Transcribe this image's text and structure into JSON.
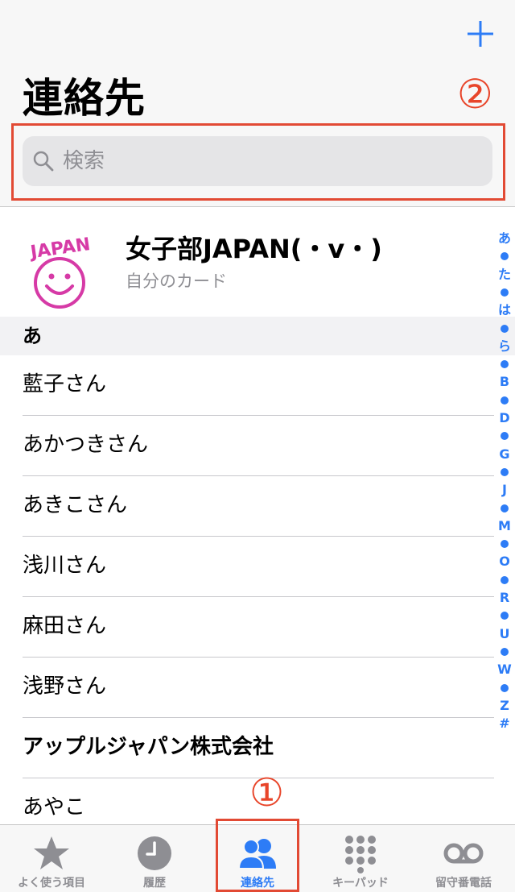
{
  "header": {
    "title": "連絡先",
    "add_icon": "plus-icon",
    "search_placeholder": "検索"
  },
  "annotations": {
    "search_marker": "②",
    "tab_marker": "①",
    "color": "#e24a34"
  },
  "my_card": {
    "name": "女子部JAPAN(・v・)",
    "subtitle": "自分のカード",
    "avatar_text": "JAPAN"
  },
  "sections": [
    {
      "header": "あ"
    }
  ],
  "contacts": [
    {
      "name": "藍子さん"
    },
    {
      "name": "あかつきさん"
    },
    {
      "name": "あきこさん"
    },
    {
      "name": "浅川さん"
    },
    {
      "name": "麻田さん"
    },
    {
      "name": "浅野さん"
    },
    {
      "name": "アップルジャパン株式会社"
    },
    {
      "name": "あやこ"
    }
  ],
  "index": [
    "あ",
    "•",
    "た",
    "•",
    "は",
    "•",
    "ら",
    "•",
    "B",
    "•",
    "D",
    "•",
    "G",
    "•",
    "J",
    "•",
    "M",
    "•",
    "O",
    "•",
    "R",
    "•",
    "U",
    "•",
    "W",
    "•",
    "Z",
    "#"
  ],
  "tabs": [
    {
      "label": "よく使う項目",
      "icon": "star-icon",
      "active": false
    },
    {
      "label": "履歴",
      "icon": "clock-icon",
      "active": false
    },
    {
      "label": "連絡先",
      "icon": "contacts-icon",
      "active": true
    },
    {
      "label": "キーパッド",
      "icon": "keypad-icon",
      "active": false
    },
    {
      "label": "留守番電話",
      "icon": "voicemail-icon",
      "active": false
    }
  ],
  "colors": {
    "accent": "#2d7cf6",
    "inactive": "#8e8e93",
    "avatar": "#d63aa6"
  }
}
